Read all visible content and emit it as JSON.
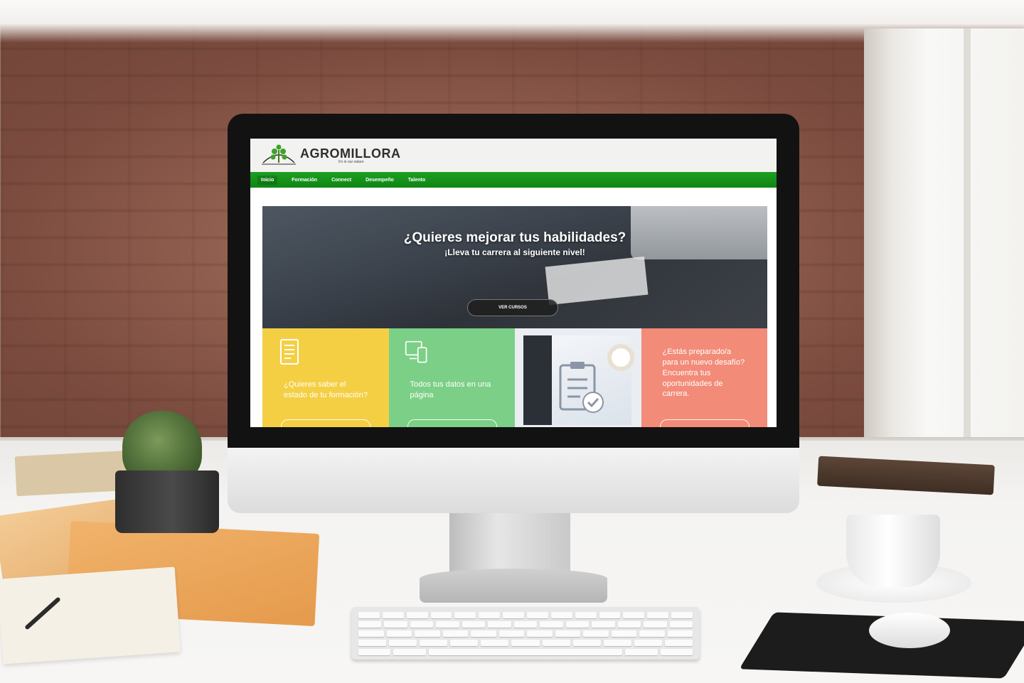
{
  "site": {
    "logo_text": "AGROMILLORA",
    "logo_sub": "It's in our nature",
    "brand_color": "#0d8612"
  },
  "nav": {
    "items": [
      {
        "label": "Inicio"
      },
      {
        "label": "Formación"
      },
      {
        "label": "Connect"
      },
      {
        "label": "Desempeño"
      },
      {
        "label": "Talento"
      }
    ]
  },
  "hero": {
    "title": "¿Quieres mejorar tus habilidades?",
    "subtitle": "¡Lleva tu carrera al siguiente nivel!",
    "button_label": "VER CURSOS"
  },
  "tiles": [
    {
      "text": "¿Quieres saber el estado de tu formación?",
      "icon": "document-icon",
      "color": "#f4cf43"
    },
    {
      "text": "Todos tus datos en una página",
      "icon": "devices-icon",
      "color": "#7ccf86"
    },
    {
      "text": "",
      "icon": "clipboard-check-icon",
      "color": "#eaedf1"
    },
    {
      "text": "¿Estás preparado/a para un nuevo desafío? Encuentra tus oportunidades de carrera.",
      "icon": "",
      "color": "#f28b78"
    }
  ]
}
